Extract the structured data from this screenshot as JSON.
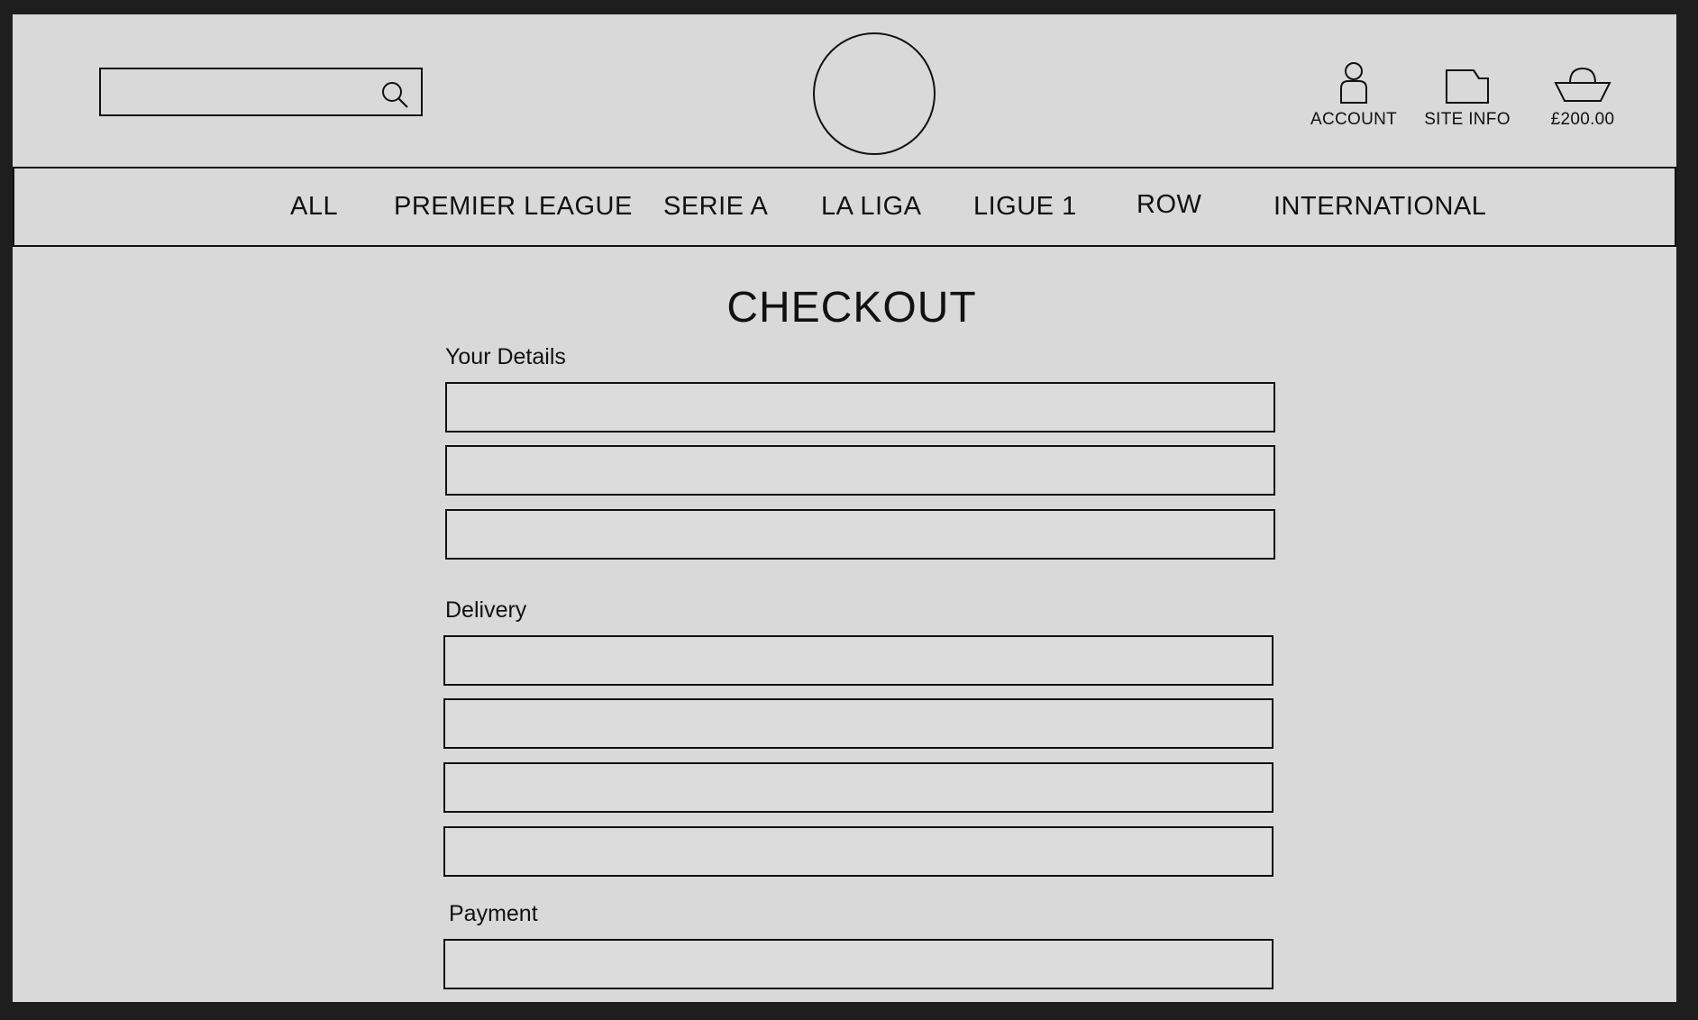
{
  "header": {
    "search": {
      "placeholder": "",
      "value": ""
    },
    "account_label": "ACCOUNT",
    "site_info_label": "SITE INFO",
    "basket_total": "£200.00"
  },
  "nav": {
    "items": [
      {
        "label": "ALL"
      },
      {
        "label": "PREMIER LEAGUE"
      },
      {
        "label": "SERIE A"
      },
      {
        "label": "LA LIGA"
      },
      {
        "label": "LIGUE 1"
      },
      {
        "label": "ROW"
      },
      {
        "label": "INTERNATIONAL"
      }
    ]
  },
  "main": {
    "title": "CHECKOUT",
    "sections": {
      "details": {
        "label": "Your Details",
        "field_count": 3
      },
      "delivery": {
        "label": "Delivery",
        "field_count": 4
      },
      "payment": {
        "label": "Payment",
        "field_count": 1
      }
    }
  },
  "icons": {
    "search": "search-icon",
    "account": "user-icon",
    "site_info": "folder-icon",
    "basket": "basket-icon"
  },
  "colors": {
    "background": "#1e1e1e",
    "page": "#d9d9d9",
    "stroke": "#111111"
  }
}
